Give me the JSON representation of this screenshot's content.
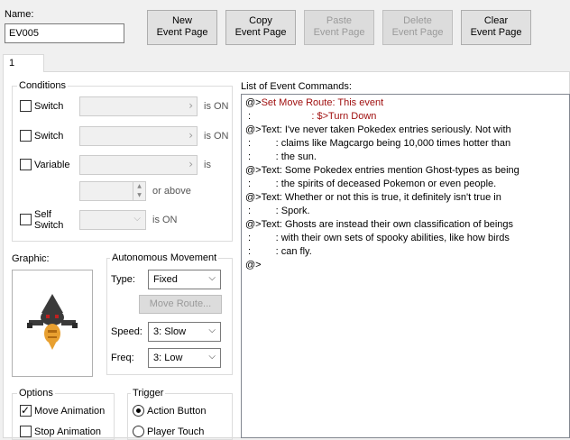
{
  "name": {
    "label": "Name:",
    "value": "EV005"
  },
  "buttons": {
    "new_page": "New\nEvent Page",
    "copy_page": "Copy\nEvent Page",
    "paste_page": "Paste\nEvent Page",
    "delete_page": "Delete\nEvent Page",
    "clear_page": "Clear\nEvent Page"
  },
  "tabs": [
    "1"
  ],
  "conditions": {
    "title": "Conditions",
    "switch1": {
      "label": "Switch",
      "suffix": "is ON"
    },
    "switch2": {
      "label": "Switch",
      "suffix": "is ON"
    },
    "variable": {
      "label": "Variable",
      "suffix": "is",
      "or_above": "or above"
    },
    "self_switch": {
      "label_line1": "Self",
      "label_line2": "Switch",
      "suffix": "is ON"
    }
  },
  "graphic": {
    "label": "Graphic:"
  },
  "autonomous": {
    "title": "Autonomous Movement",
    "type_label": "Type:",
    "type_value": "Fixed",
    "move_route_button": "Move Route...",
    "speed_label": "Speed:",
    "speed_value": "3: Slow",
    "freq_label": "Freq:",
    "freq_value": "3: Low"
  },
  "options": {
    "title": "Options",
    "move_animation": {
      "label": "Move Animation",
      "checked": true
    },
    "stop_animation": {
      "label": "Stop Animation",
      "checked": false
    }
  },
  "trigger": {
    "title": "Trigger",
    "action_button": {
      "label": "Action Button",
      "selected": true
    },
    "player_touch": {
      "label": "Player Touch",
      "selected": false
    }
  },
  "event_commands": {
    "label": "List of Event Commands:",
    "lines": [
      {
        "prefix": "@>",
        "text": "Set Move Route: This event",
        "red": true
      },
      {
        "prefix": " :",
        "text": "                      : $>Turn Down",
        "red": true
      },
      {
        "prefix": "@>",
        "text": "Text: I've never taken Pokedex entries seriously. Not with",
        "red": false
      },
      {
        "prefix": " :",
        "text": "         : claims like Magcargo being 10,000 times hotter than",
        "red": false
      },
      {
        "prefix": " :",
        "text": "         : the sun.",
        "red": false
      },
      {
        "prefix": "@>",
        "text": "Text: Some Pokedex entries mention Ghost-types as being",
        "red": false
      },
      {
        "prefix": " :",
        "text": "         : the spirits of deceased Pokemon or even people.",
        "red": false
      },
      {
        "prefix": "@>",
        "text": "Text: Whether or not this is true, it definitely isn't true in",
        "red": false
      },
      {
        "prefix": " :",
        "text": "         : Spork.",
        "red": false
      },
      {
        "prefix": "@>",
        "text": "Text: Ghosts are instead their own classification of beings",
        "red": false
      },
      {
        "prefix": " :",
        "text": "         : with their own sets of spooky abilities, like how birds",
        "red": false
      },
      {
        "prefix": " :",
        "text": "         : can fly.",
        "red": false
      },
      {
        "prefix": "@>",
        "text": "",
        "red": false
      }
    ]
  },
  "colors": {
    "command_red": "#a01010",
    "sprite_dark": "#3a3a3a",
    "sprite_orange": "#e8a030",
    "sprite_eye": "#c02020"
  }
}
